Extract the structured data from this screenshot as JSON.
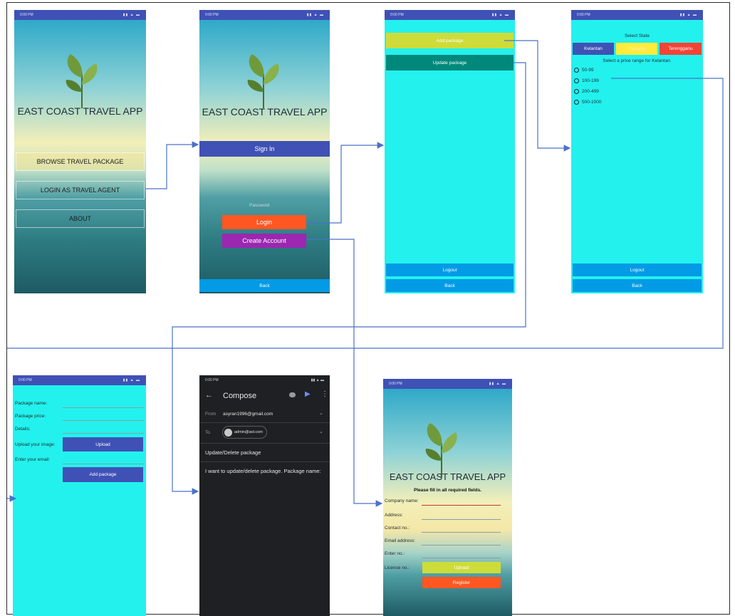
{
  "colors": {
    "status_bar": "#3f51b5",
    "cyan_bg": "#23f1ee",
    "indigo_button": "#3f51b5",
    "orange_button": "#ff5722",
    "purple_button": "#9c27b0",
    "blue_button": "#039be5",
    "lime_button": "#cddc39",
    "teal_button": "#00897b",
    "yellow_button": "#ffeb3b",
    "red_button": "#f44336",
    "arrow": "#4a72c8"
  },
  "screens": {
    "home": {
      "title": "EAST COAST TRAVEL APP",
      "menu": [
        "BROWSE TRAVEL PACKAGE",
        "LOGIN AS TRAVEL AGENT",
        "ABOUT"
      ]
    },
    "login": {
      "title": "EAST COAST TRAVEL APP",
      "sign_in": "Sign In",
      "password_placeholder": "Password",
      "login_button": "Login",
      "create_account_button": "Create Account",
      "back_button": "Back"
    },
    "agent_menu": {
      "add_package": "Add package",
      "update_package": "Update package",
      "logout": "Logout",
      "back": "Back"
    },
    "browse": {
      "select_state": "Select State",
      "states": [
        "Kelantan",
        "Pahang",
        "Terengganu"
      ],
      "price_prompt": "Select a price range for Kelantan.",
      "ranges": [
        "50-99",
        "100-199",
        "200-499",
        "500-1000"
      ],
      "logout": "Logout",
      "back": "Back"
    },
    "add_package_form": {
      "fields": [
        "Package name:",
        "Package price:",
        "Details:"
      ],
      "upload_label": "Upload your image:",
      "upload_button": "Upload",
      "email_label": "Enter your email:",
      "submit_button": "Add package"
    },
    "compose": {
      "title": "Compose",
      "from_label": "From",
      "from_value": "asyran1996@gmail.com",
      "to_label": "To",
      "to_value": "admin@aol.com",
      "subject": "Update/Delete package",
      "body": "I want to update/delete package. Package name:"
    },
    "register": {
      "title": "EAST COAST TRAVEL APP",
      "instruction": "Please fill in all required fields.",
      "fields": [
        "Company name:",
        "Address:",
        "Contact no.:",
        "Email address:",
        "Enter no.:",
        "License no.:"
      ],
      "upload_button": "Upload",
      "register_button": "Register"
    }
  }
}
